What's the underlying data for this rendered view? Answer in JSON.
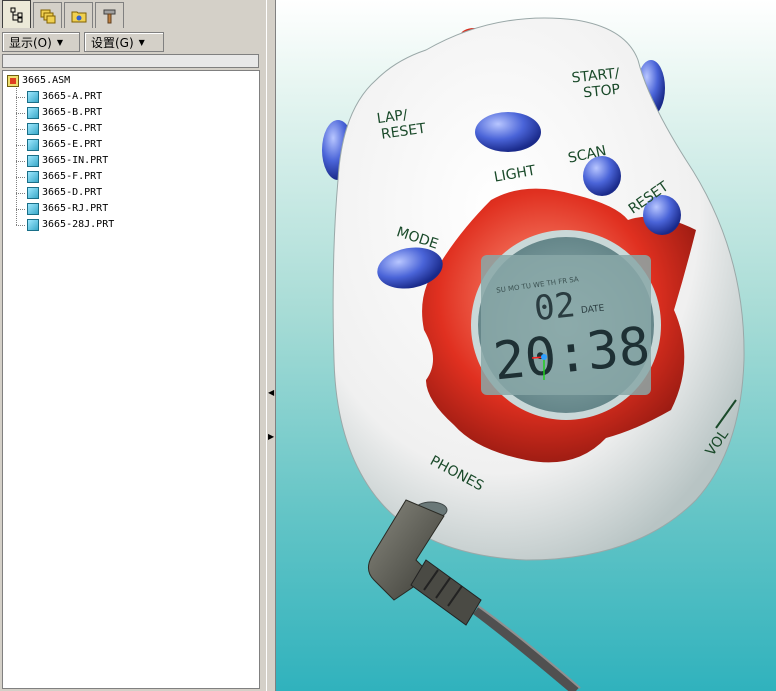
{
  "toolbar": {
    "show_menu": "显示(O)",
    "settings_menu": "设置(G)"
  },
  "model_tree": {
    "root": "3665.ASM",
    "items": [
      "3665-A.PRT",
      "3665-B.PRT",
      "3665-C.PRT",
      "3665-E.PRT",
      "3665-IN.PRT",
      "3665-F.PRT",
      "3665-D.PRT",
      "3665-RJ.PRT",
      "3665-28J.PRT"
    ]
  },
  "device": {
    "labels": {
      "lap_reset": "LAP/ RESET",
      "start_stop": "START/ STOP",
      "light": "LIGHT",
      "scan": "SCAN",
      "reset": "RESET",
      "mode": "MODE",
      "phones": "PHONES",
      "vol": "VOL"
    },
    "display": {
      "date_value": "02",
      "date_label": "DATE",
      "time_value": "20:38",
      "weekdays": "SU MO TU WE TH FR SA"
    }
  },
  "colors": {
    "body": "#f5f5f5",
    "bezel": "#e03020",
    "buttons": "#4a64d8",
    "lcd": "#8aa8a8",
    "viewport_bottom": "#30b2bd"
  }
}
